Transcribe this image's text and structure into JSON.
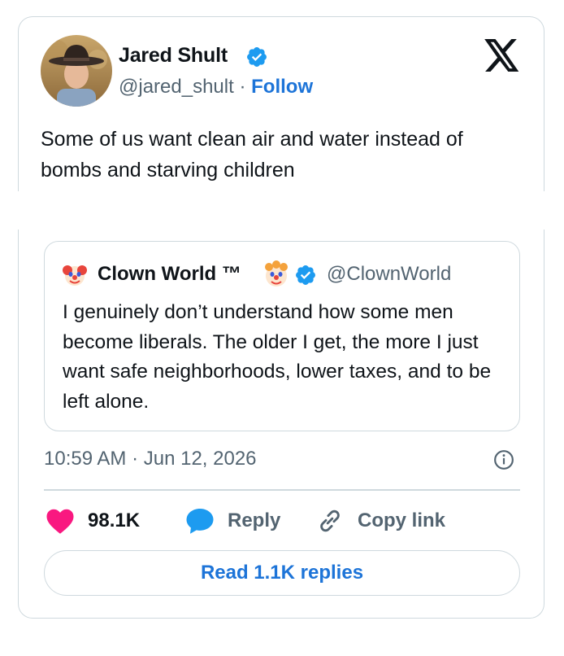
{
  "tweet": {
    "author": {
      "name": "Jared Shult",
      "handle": "@jared_shult",
      "separator": "·",
      "follow_label": "Follow"
    },
    "text": "Some of us want clean air and water instead of bombs and starving children",
    "timestamp": "10:59 AM · Jun 12, 2026"
  },
  "quote": {
    "author": {
      "name": "Clown World ™",
      "handle": "@ClownWorld"
    },
    "text": "I genuinely don’t understand how some men become liberals. The older I get, the more I just want safe neighborhoods, lower taxes, and to be left alone."
  },
  "actions": {
    "likes": "98.1K",
    "reply_label": "Reply",
    "copy_link_label": "Copy link",
    "read_replies_label": "Read 1.1K replies"
  },
  "colors": {
    "accent_blue": "#1d74d8",
    "like_pink": "#f91880",
    "reply_blue": "#1d9bf0",
    "border": "#cfd9de",
    "muted_text": "#536471"
  },
  "icons": {
    "brand": "x-logo-icon",
    "verified": "verified-badge-icon",
    "clown": "clown-face-icon",
    "info": "info-icon",
    "like": "heart-icon",
    "reply": "speech-bubble-icon",
    "copy": "link-icon"
  }
}
